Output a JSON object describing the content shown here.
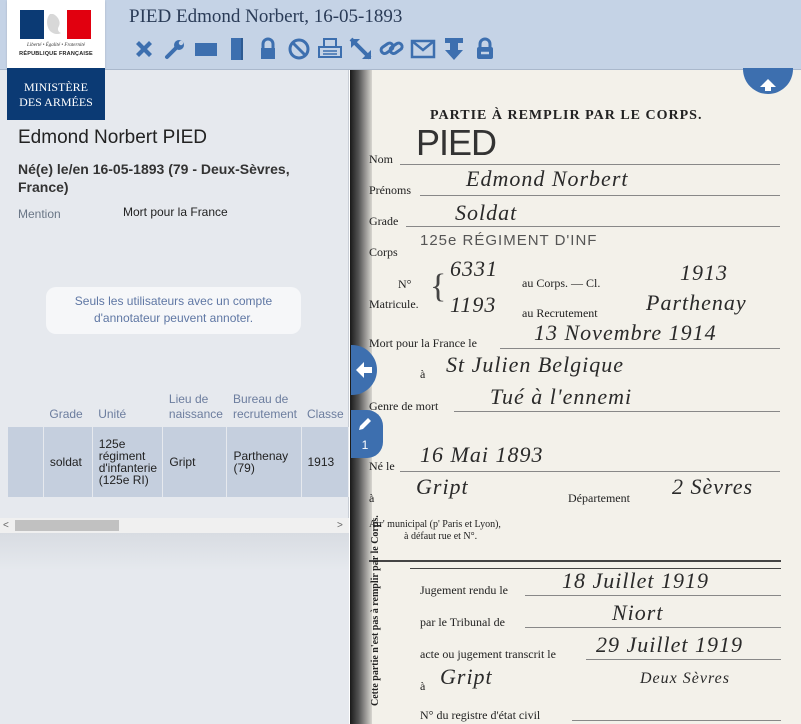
{
  "header": {
    "title": "PIED Edmond Norbert, 16-05-1893"
  },
  "logo": {
    "motto": "Liberté • Égalité • Fraternité",
    "republic": "RÉPUBLIQUE FRANÇAISE",
    "ministry_line1": "MINISTÈRE",
    "ministry_line2": "DES ARMÉES"
  },
  "toolbar": {
    "icons": [
      "close-icon",
      "wrench-icon",
      "single-page-icon",
      "vertical-layout-icon",
      "lock-icon",
      "block-icon",
      "print-icon",
      "fullscreen-icon",
      "link-icon",
      "email-icon",
      "download-icon",
      "unlock-icon"
    ]
  },
  "person": {
    "name": "Edmond Norbert PIED",
    "born": "Né(e) le/en 16-05-1893 (79 - Deux-Sèvres, France)",
    "mention_label": "Mention",
    "mention_value": "Mort pour la France"
  },
  "notice": {
    "text": "Seuls les utilisateurs avec un compte d'annotateur peuvent annoter."
  },
  "table": {
    "headers": [
      "",
      "Grade",
      "Unité",
      "Lieu de naissance",
      "Bureau de recrutement",
      "Classe"
    ],
    "rows": [
      [
        "",
        "soldat",
        "125e régiment d'infanterie (125e RI)",
        "Gript",
        "Parthenay (79)",
        "1913"
      ]
    ]
  },
  "scrollbar": {
    "left_arrow": "<",
    "right_arrow": ">"
  },
  "document": {
    "heading": "PARTIE À REMPLIR PAR LE CORPS.",
    "labels": {
      "nom": "Nom",
      "prenoms": "Prénoms",
      "grade": "Grade",
      "corps": "Corps",
      "no": "N°",
      "matricule": "Matricule.",
      "au_corps": "au Corps. — Cl.",
      "au_recrutement": "au Recrutement",
      "mort": "Mort pour la France le",
      "a1": "à",
      "genre": "Genre de mort",
      "ne": "Né le",
      "a2": "à",
      "departement": "Département",
      "arr": "Arr' municipal (p' Paris et Lyon),",
      "defaut": "à défaut rue et N°.",
      "jugement": "Jugement rendu le",
      "tribunal": "par le Tribunal de",
      "acte": "acte ou jugement transcrit le",
      "a3": "à",
      "registre": "N° du registre d'état civil",
      "side_note": "Cette partie n'est pas à remplir par le Corps."
    },
    "handwriting": {
      "nom": "PIED",
      "prenoms": "Edmond Norbert",
      "grade": "Soldat",
      "corps": "125e RÉGIMENT D'INF",
      "no_corps": "6331",
      "classe": "1913",
      "no_recrutement": "1193",
      "recrutement": "Parthenay",
      "mort_date": "13 Novembre 1914",
      "mort_lieu": "St Julien Belgique",
      "genre": "Tué à l'ennemi",
      "ne_date": "16 Mai 1893",
      "ne_lieu": "Gript",
      "departement": "2 Sèvres",
      "jugement_date": "18 Juillet 1919",
      "tribunal": "Niort",
      "transcrit": "29 Juillet 1919",
      "transcrit_lieu": "Gript",
      "transcrit_dept": "Deux Sèvres"
    }
  },
  "annotations": {
    "count": "1"
  },
  "colors": {
    "header_bg": "#c5d3e6",
    "accent": "#3d6faf",
    "ministry_blue": "#0b3a74",
    "panel_bg": "#e6e9ee",
    "row_bg": "#c5cfde"
  }
}
